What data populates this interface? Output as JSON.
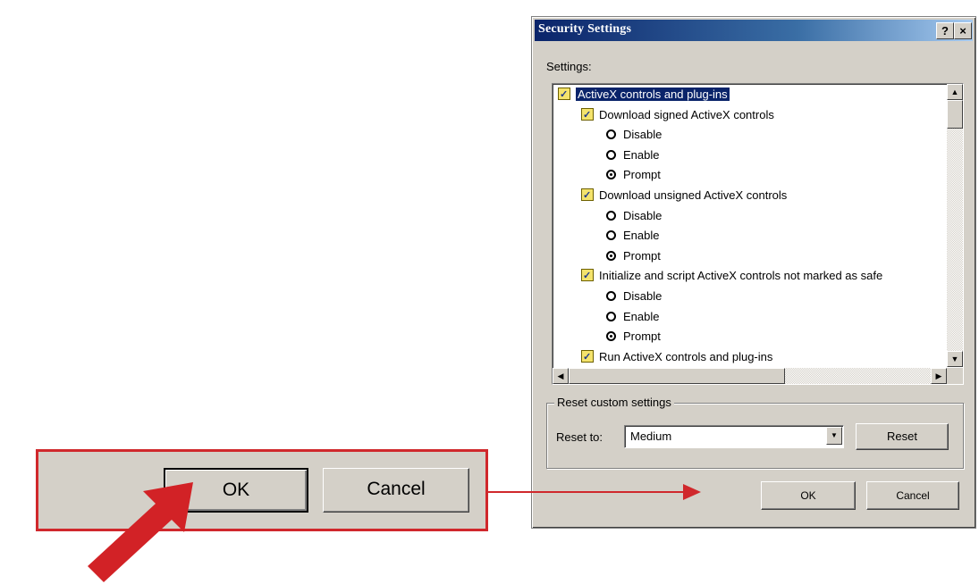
{
  "dialog": {
    "title": "Security Settings",
    "help_button": "?",
    "close_button": "×",
    "settings_label": "Settings:",
    "tree": [
      {
        "type": "category",
        "label": "ActiveX controls and plug-ins",
        "selected": true
      },
      {
        "type": "setting",
        "label": "Download signed ActiveX controls"
      },
      {
        "type": "option",
        "label": "Disable",
        "checked": false
      },
      {
        "type": "option",
        "label": "Enable",
        "checked": false
      },
      {
        "type": "option",
        "label": "Prompt",
        "checked": true
      },
      {
        "type": "setting",
        "label": "Download unsigned ActiveX controls"
      },
      {
        "type": "option",
        "label": "Disable",
        "checked": false
      },
      {
        "type": "option",
        "label": "Enable",
        "checked": false
      },
      {
        "type": "option",
        "label": "Prompt",
        "checked": true
      },
      {
        "type": "setting",
        "label": "Initialize and script ActiveX controls not marked as safe"
      },
      {
        "type": "option",
        "label": "Disable",
        "checked": false
      },
      {
        "type": "option",
        "label": "Enable",
        "checked": false
      },
      {
        "type": "option",
        "label": "Prompt",
        "checked": true
      },
      {
        "type": "setting",
        "label": "Run ActiveX controls and plug-ins"
      }
    ],
    "reset_group": {
      "legend": "Reset custom settings",
      "label": "Reset to:",
      "value": "Medium",
      "reset_button": "Reset"
    },
    "ok_button": "OK",
    "cancel_button": "Cancel"
  },
  "zoom_callout": {
    "ok_button": "OK",
    "cancel_button": "Cancel"
  },
  "colors": {
    "titlebar_start": "#0a246a",
    "titlebar_end": "#a6caf0",
    "dialog_face": "#d4d0c8",
    "selection": "#0a246a",
    "callout_red": "#d0282c"
  }
}
